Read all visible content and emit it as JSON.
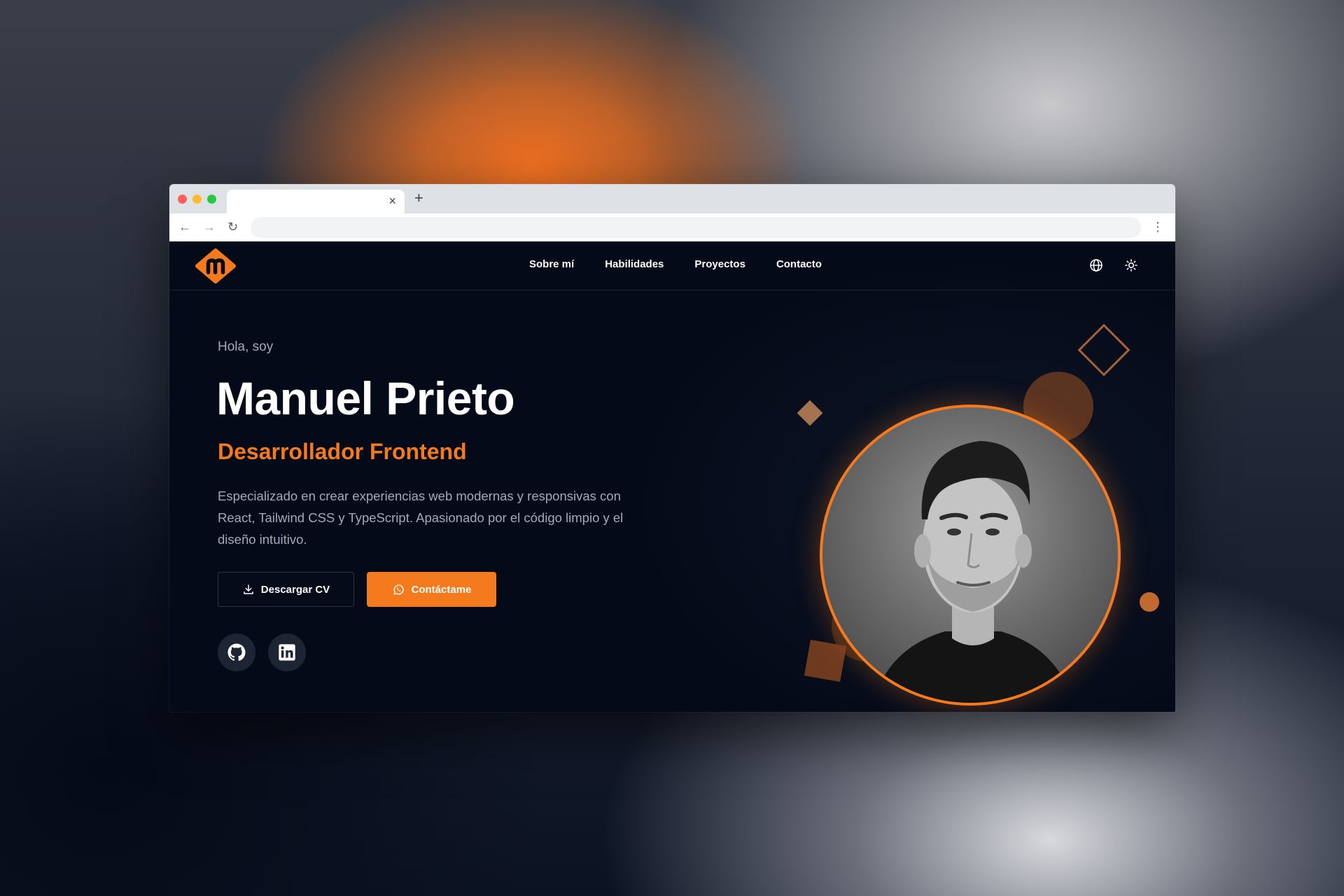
{
  "browser": {
    "tab": {
      "close_glyph": "×"
    },
    "new_tab_glyph": "+",
    "toolbar": {
      "back": "←",
      "forward": "→",
      "reload": "↻",
      "menu": "⋮"
    }
  },
  "site": {
    "nav": {
      "links": [
        "Sobre mí",
        "Habilidades",
        "Proyectos",
        "Contacto"
      ],
      "icons": [
        "globe-icon",
        "sun-icon"
      ]
    },
    "hero": {
      "greeting": "Hola, soy",
      "name": "Manuel Prieto",
      "role": "Desarrollador Frontend",
      "description": "Especializado en crear experiencias web modernas y responsivas con React, Tailwind CSS y TypeScript. Apasionado por el código limpio y el diseño intuitivo.",
      "buttons": {
        "cv": "Descargar CV",
        "contact": "Contáctame"
      },
      "socials": [
        "github-icon",
        "linkedin-icon"
      ]
    },
    "colors": {
      "accent": "#f57a1e",
      "background": "#050a18",
      "text_muted": "#a3a9b8"
    }
  }
}
